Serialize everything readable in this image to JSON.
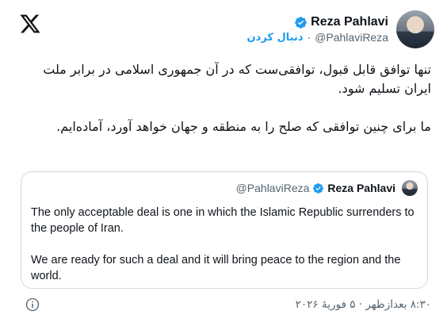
{
  "header": {
    "logo_icon": "x-logo-icon",
    "display_name": "Reza Pahlavi",
    "handle": "@PahlaviReza",
    "separator": "·",
    "follow_label": "دنبال کردن",
    "verified_icon": "verified-badge-icon",
    "verified_color": "#1d9bf0"
  },
  "tweet": {
    "paragraph_1": "تنها توافق قابل قبول، توافقی‌ست که در آن جمهوری اسلامی در برابر ملت ایران تسلیم شود.",
    "paragraph_2": "ما برای چنین توافقی که صلح را به منطقه و جهان خواهد آورد، آماده‌ایم."
  },
  "quote": {
    "display_name": "Reza Pahlavi",
    "handle": "@PahlaviReza",
    "paragraph_1": "The only acceptable deal is one in which the Islamic Republic surrenders to the people of Iran.",
    "paragraph_2": "We are ready for such a deal and it will bring peace to the region and the world."
  },
  "footer": {
    "timestamp": "۸:۳۰ بعدازظهر · ۵ فوریهٔ ۲۰۲۶",
    "info_icon": "info-icon"
  }
}
